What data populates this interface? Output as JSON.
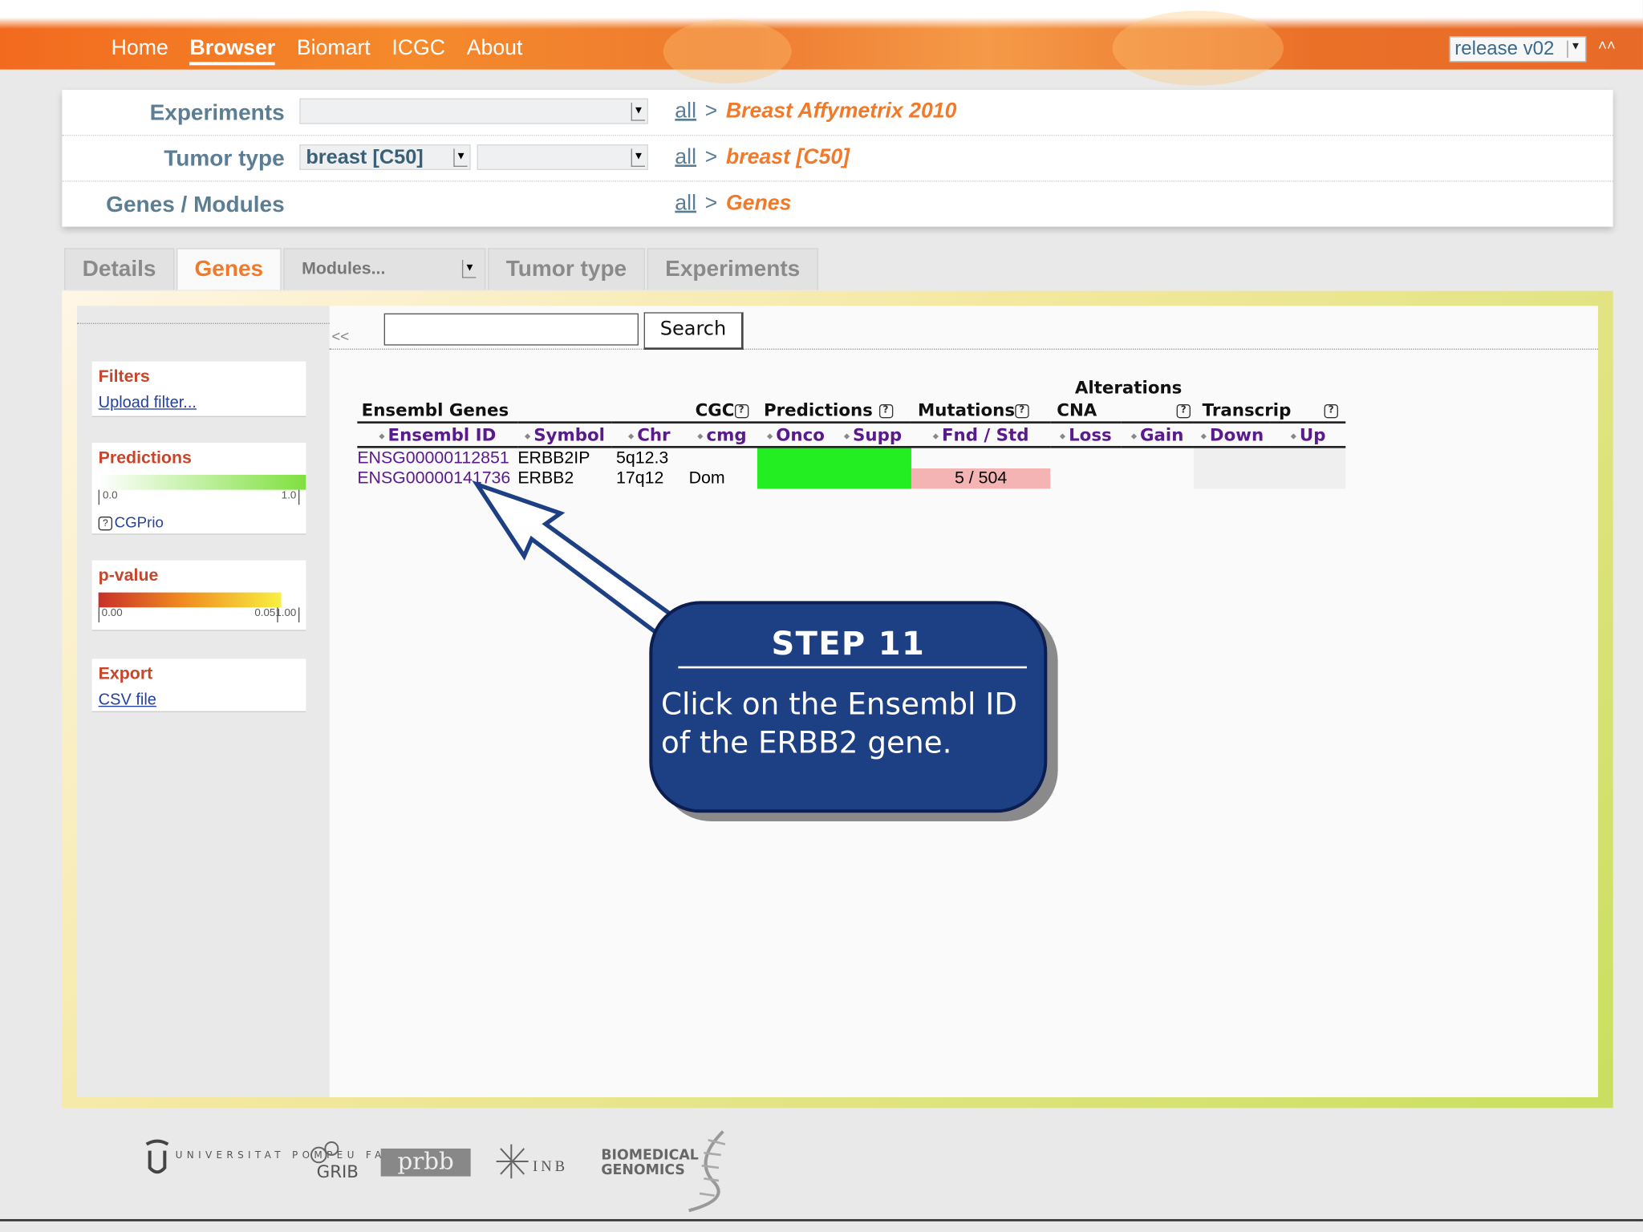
{
  "nav": {
    "items": [
      "Home",
      "Browser",
      "Biomart",
      "ICGC",
      "About"
    ],
    "active": "Browser",
    "release": "release v02"
  },
  "filters": {
    "experiments": {
      "label": "Experiments",
      "select_value": "",
      "crumb_all": "all",
      "crumb_sep": ">",
      "crumb_current": "Breast Affymetrix 2010"
    },
    "tumor_type": {
      "label": "Tumor type",
      "select_value": "breast [C50]",
      "select2_value": "",
      "crumb_all": "all",
      "crumb_sep": ">",
      "crumb_current": "breast [C50]"
    },
    "genes_modules": {
      "label": "Genes / Modules",
      "crumb_all": "all",
      "crumb_sep": ">",
      "crumb_current": "Genes"
    }
  },
  "tabs": {
    "details": "Details",
    "genes": "Genes",
    "modules": "Modules...",
    "tumor_type": "Tumor type",
    "experiments": "Experiments",
    "active": "Genes"
  },
  "sidebar": {
    "collapse": "<<",
    "filters_title": "Filters",
    "upload_filter": "Upload filter...",
    "predictions_title": "Predictions",
    "predictions_min": "0.0",
    "predictions_max": "1.0",
    "cgprio": "CGPrio",
    "pvalue_title": "p-value",
    "pvalue_min": "0.00",
    "pvalue_mid": "0.05",
    "pvalue_max": "1.00",
    "export_title": "Export",
    "csv_file": "CSV file"
  },
  "search": {
    "value": "",
    "button": "Search"
  },
  "table": {
    "group_alterations": "Alterations",
    "h1": {
      "ensembl_genes": "Ensembl Genes",
      "cgc": "CGC",
      "predictions": "Predictions",
      "mutations": "Mutations",
      "cna": "CNA",
      "transcrip": "Transcrip"
    },
    "h2": {
      "ensembl_id": "Ensembl ID",
      "symbol": "Symbol",
      "chr": "Chr",
      "cmg": "cmg",
      "onco": "Onco",
      "supp": "Supp",
      "fnd_std": "Fnd / Std",
      "loss": "Loss",
      "gain": "Gain",
      "down": "Down",
      "up": "Up"
    },
    "rows": [
      {
        "ensembl_id": "ENSG00000112851",
        "symbol": "ERBB2IP",
        "chr": "5q12.3",
        "cgc": "",
        "mutations": ""
      },
      {
        "ensembl_id": "ENSG00000141736",
        "symbol": "ERBB2",
        "chr": "17q12",
        "cgc": "Dom",
        "mutations": "5 / 504"
      }
    ]
  },
  "callout": {
    "step": "STEP 11",
    "message": "Click on the Ensembl ID of the ERBB2 gene."
  },
  "footer": {
    "logos": [
      "UNIVERSITAT POMPEU FABRA",
      "GRIB",
      "prbb",
      "INB",
      "BIOMEDICAL GENOMICS"
    ]
  },
  "colors": {
    "accent_orange": "#f07a2a",
    "label_blue": "#5b7e95",
    "callout_blue": "#1d3f84",
    "prediction_green": "#22ee22",
    "mutation_pink": "#f4b4b4"
  }
}
